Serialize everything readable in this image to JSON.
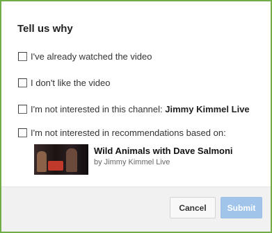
{
  "dialog": {
    "title": "Tell us why"
  },
  "options": [
    {
      "label": "I've already watched the video",
      "checked": false
    },
    {
      "label": "I don't like the video",
      "checked": false
    },
    {
      "label": "I'm not interested in this channel: ",
      "emphasis": "Jimmy Kimmel Live",
      "checked": false
    },
    {
      "label": "I'm not interested in recommendations based on:",
      "checked": false
    }
  ],
  "video": {
    "title": "Wild Animals with Dave Salmoni",
    "channel": "by Jimmy Kimmel Live"
  },
  "buttons": {
    "cancel": "Cancel",
    "submit": "Submit"
  },
  "colors": {
    "frame_border": "#70ad47",
    "submit_disabled": "#a0c4ea",
    "footer_bg": "#f1f1f1"
  }
}
